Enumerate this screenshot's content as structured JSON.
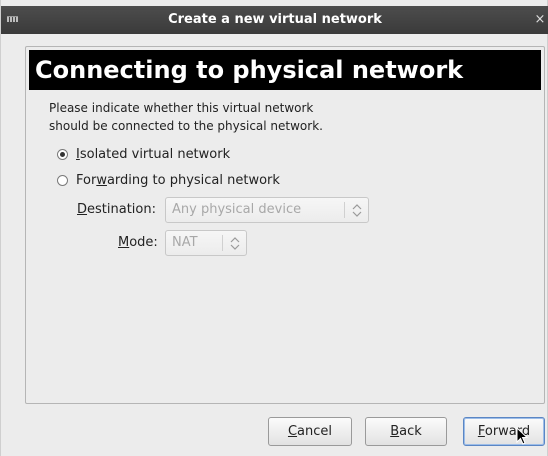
{
  "window": {
    "title": "Create a new virtual network",
    "menu_icon": "window-menu-icon",
    "close_glyph": "×"
  },
  "banner": {
    "heading": "Connecting to physical network"
  },
  "description": {
    "line1": "Please indicate whether this virtual network",
    "line2": "should be connected to the physical network."
  },
  "options": {
    "isolated": {
      "accel": "I",
      "rest": "solated virtual network",
      "selected": true
    },
    "forwarding": {
      "pre": "For",
      "accel": "w",
      "rest": "arding to physical network",
      "selected": false
    }
  },
  "destination": {
    "label_accel": "D",
    "label_rest": "estination:",
    "value": "Any physical device",
    "enabled": false
  },
  "mode": {
    "label_accel": "M",
    "label_rest": "ode:",
    "value": "NAT",
    "enabled": false
  },
  "buttons": {
    "cancel": {
      "accel": "C",
      "rest": "ancel"
    },
    "back": {
      "accel": "B",
      "rest": "ack"
    },
    "forward": {
      "accel": "F",
      "rest": "orward"
    }
  },
  "colors": {
    "titlebar": "#3f3f3f",
    "banner": "#000000",
    "window_bg": "#ececec",
    "focus_border": "#5b86c4",
    "disabled_text": "#a8a8a8"
  }
}
